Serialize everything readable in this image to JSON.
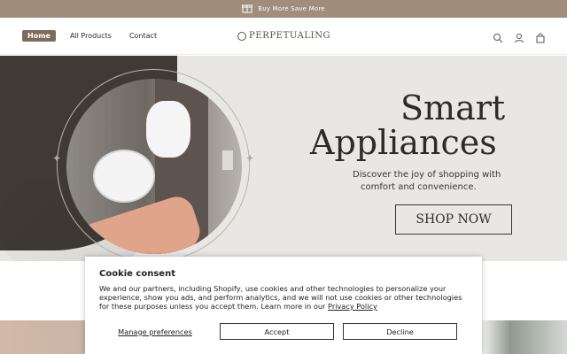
{
  "announcement": {
    "text": "Buy More Save More",
    "icon": "gift-icon"
  },
  "nav": {
    "items": [
      "Home",
      "All Products",
      "Contact"
    ],
    "active": "Home"
  },
  "logo": {
    "text": "PERPETUALING"
  },
  "header_icons": [
    "search-icon",
    "account-icon",
    "cart-icon"
  ],
  "hero": {
    "title_line1": "Smart",
    "title_line2": "Appliances",
    "subtitle_line1": "Discover the joy of shopping with",
    "subtitle_line2": "comfort and convenience.",
    "cta": "SHOP NOW"
  },
  "cookie": {
    "title": "Cookie consent",
    "body": "We and our partners, including Shopify, use cookies and other technologies to personalize your experience, show you ads, and perform analytics, and we will not use cookies or other technologies for these purposes unless you accept them. Learn more in our ",
    "policy_link": "Privacy Policy",
    "manage": "Manage preferences",
    "accept": "Accept",
    "decline": "Decline"
  },
  "colors": {
    "announcement_bg": "#a08d7c",
    "active_nav": "#7d6c5c",
    "hero_bg": "#e9e7e4",
    "dark_accent": "#3f3a33"
  }
}
